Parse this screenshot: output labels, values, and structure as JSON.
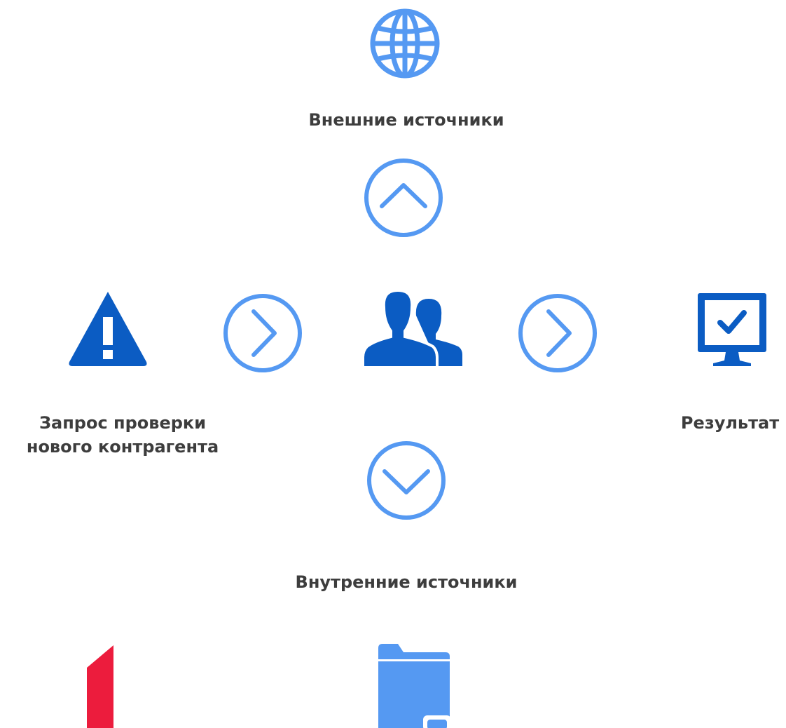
{
  "colors": {
    "light_blue": "#5599f2",
    "dark_blue": "#0b5cc3",
    "red": "#ec1c3d",
    "text": "#3d3d3d"
  },
  "nodes": {
    "external_sources": {
      "icon": "globe-icon",
      "label": "Внешние источники"
    },
    "request": {
      "icon": "warning-icon",
      "label_line1": "Запрос проверки",
      "label_line2": "нового контрагента"
    },
    "people": {
      "icon": "users-icon"
    },
    "result": {
      "icon": "monitor-check-icon",
      "label": "Результат"
    },
    "internal_sources": {
      "label": "Внутренние источники"
    },
    "internal_source_1": {
      "icon": "red-logo-icon"
    },
    "internal_source_2": {
      "icon": "folder-icon"
    }
  },
  "arrows": {
    "up": {
      "icon": "chevron-up-icon"
    },
    "left_right": {
      "icon": "chevron-right-icon"
    },
    "right_right": {
      "icon": "chevron-right-icon"
    },
    "down": {
      "icon": "chevron-down-icon"
    }
  }
}
